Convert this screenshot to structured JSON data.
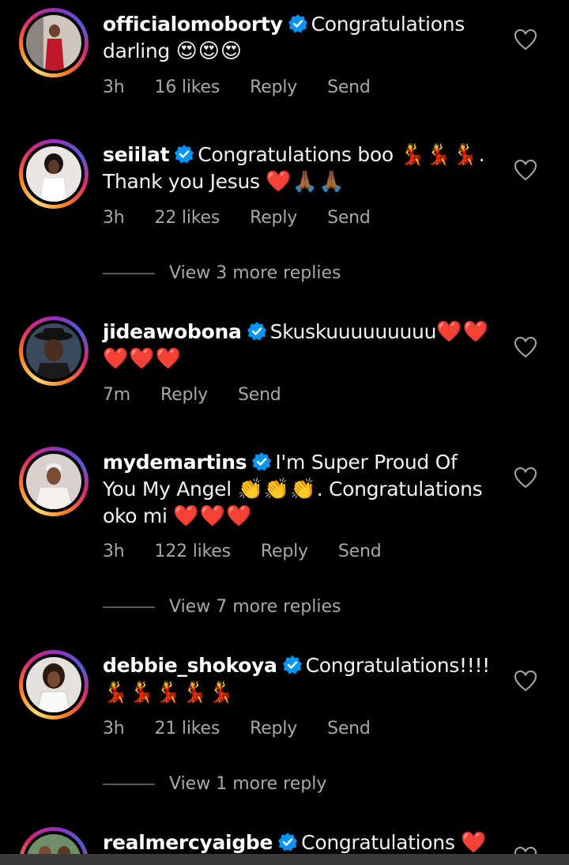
{
  "comments": [
    {
      "username": "officialomoborty",
      "text": "Congratulations darling",
      "emoji": "😍😍😍",
      "time": "3h",
      "likes": "16 likes",
      "reply": "Reply",
      "send": "Send"
    },
    {
      "username": "seiilat",
      "text": "Congratulations boo",
      "emoji1": "💃💃💃",
      "text2": ". Thank you Jesus",
      "emoji2": "❤️🙏🏾🙏🏾",
      "time": "3h",
      "likes": "22 likes",
      "reply": "Reply",
      "send": "Send",
      "view_replies": "View 3 more replies"
    },
    {
      "username": "jideawobona",
      "text": "Skuskuuuuuuuuu",
      "emoji": "❤️❤️❤️❤️❤️",
      "time": "7m",
      "reply": "Reply",
      "send": "Send"
    },
    {
      "username": "mydemartins",
      "text": "I'm Super Proud Of You My Angel",
      "emoji1": "👏👏👏",
      "text2": ". Congratulations oko mi",
      "emoji2": "❤️❤️❤️",
      "time": "3h",
      "likes": "122 likes",
      "reply": "Reply",
      "send": "Send",
      "view_replies": "View 7 more replies"
    },
    {
      "username": "debbie_shokoya",
      "text": "Congratulations!!!!",
      "emoji": "💃💃💃💃💃",
      "time": "3h",
      "likes": "21 likes",
      "reply": "Reply",
      "send": "Send",
      "view_replies": "View 1 more reply"
    },
    {
      "username": "realmercyaigbe",
      "text": "Congratulations",
      "emoji": "❤️"
    }
  ],
  "colors": {
    "background": "#000000",
    "verified": "#0095f6",
    "meta": "#a8a8a8",
    "heart": "#e11b2d"
  }
}
